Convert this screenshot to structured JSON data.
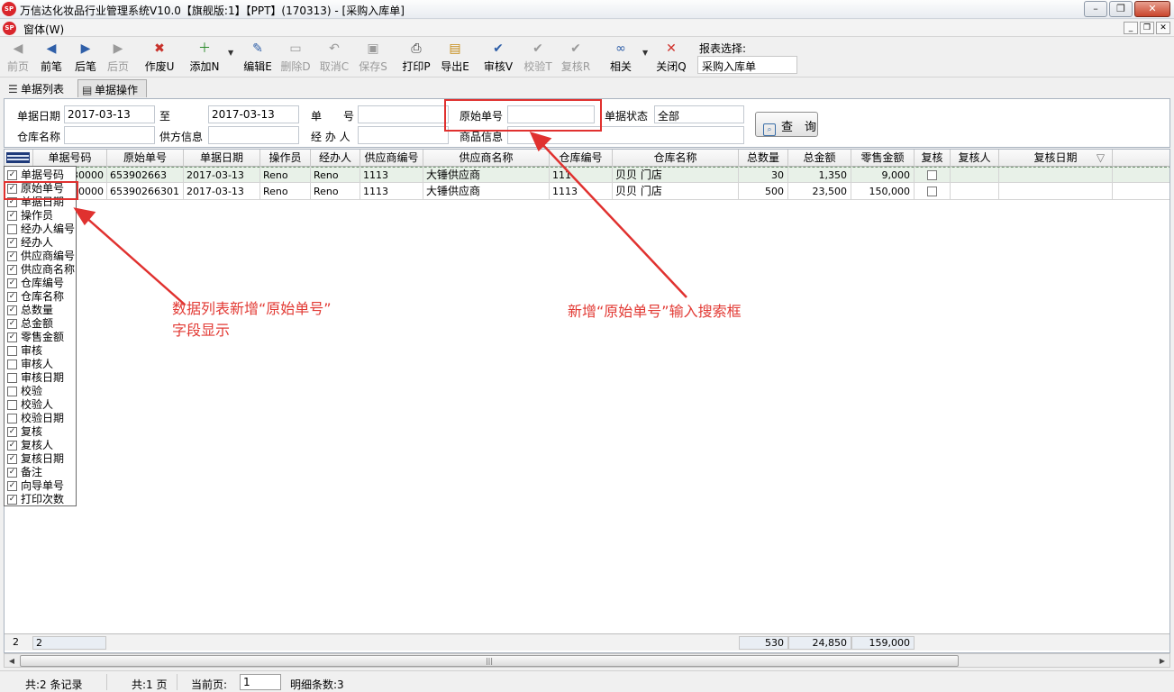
{
  "window": {
    "title": "万信达化妆品行业管理系统V10.0【旗舰版:1】【PPT】(170313) - [采购入库单]",
    "logo_text": "SP"
  },
  "menubar": {
    "label": "窗体(W)"
  },
  "toolbar": {
    "buttons": [
      {
        "label": "前页",
        "icon": "first-page-icon",
        "glyph": "◀",
        "enabled": false
      },
      {
        "label": "前笔",
        "icon": "prev-record-icon",
        "glyph": "◀",
        "enabled": true
      },
      {
        "label": "后笔",
        "icon": "next-record-icon",
        "glyph": "▶",
        "enabled": true
      },
      {
        "label": "后页",
        "icon": "last-page-icon",
        "glyph": "▶",
        "enabled": false
      },
      {
        "label": "作废U",
        "icon": "void-doc-icon",
        "glyph": "✖",
        "enabled": true
      },
      {
        "label": "添加N",
        "icon": "add-doc-icon",
        "glyph": "＋",
        "enabled": true
      },
      {
        "label": "编辑E",
        "icon": "edit-doc-icon",
        "glyph": "✎",
        "enabled": true
      },
      {
        "label": "删除D",
        "icon": "delete-doc-icon",
        "glyph": "▭",
        "enabled": false
      },
      {
        "label": "取消C",
        "icon": "undo-icon",
        "glyph": "↶",
        "enabled": false
      },
      {
        "label": "保存S",
        "icon": "save-icon",
        "glyph": "▣",
        "enabled": false
      },
      {
        "label": "打印P",
        "icon": "printer-icon",
        "glyph": "⎙",
        "enabled": true
      },
      {
        "label": "导出E",
        "icon": "export-folder-icon",
        "glyph": "▤",
        "enabled": true
      },
      {
        "label": "审核V",
        "icon": "approve-icon",
        "glyph": "✔",
        "enabled": true
      },
      {
        "label": "校验T",
        "icon": "verify-icon",
        "glyph": "✔",
        "enabled": false
      },
      {
        "label": "复核R",
        "icon": "recheck-icon",
        "glyph": "✔",
        "enabled": false
      },
      {
        "label": "相关",
        "icon": "link-icon",
        "glyph": "∞",
        "enabled": true
      },
      {
        "label": "关闭Q",
        "icon": "close-x-icon",
        "glyph": "✕",
        "enabled": true
      }
    ],
    "report_label": "报表选择:",
    "report_value": "采购入库单"
  },
  "tabs": [
    {
      "label": "单据列表",
      "icon": "list-icon"
    },
    {
      "label": "单据操作",
      "icon": "form-icon"
    }
  ],
  "filters": {
    "date_label": "单据日期",
    "date_from": "2017-03-13",
    "to_label": "至",
    "date_to": "2017-03-13",
    "doc_no_label": "单　　号",
    "doc_no_value": "",
    "orig_no_label": "原始单号",
    "orig_no_value": "",
    "status_label": "单据状态",
    "status_value": "全部",
    "warehouse_label": "仓库名称",
    "warehouse_value": "",
    "supplier_label": "供方信息",
    "supplier_value": "",
    "handler_label": "经 办 人",
    "handler_value": "",
    "product_label": "商品信息",
    "product_value": "",
    "query_button": "查　询"
  },
  "grid": {
    "headers": [
      "单据号码",
      "原始单号",
      "单据日期",
      "操作员",
      "经办人",
      "供应商编号",
      "供应商名称",
      "仓库编号",
      "仓库名称",
      "总数量",
      "总金额",
      "零售金额",
      "复核",
      "复核人",
      "复核日期",
      "▽"
    ],
    "rows": [
      {
        "doc_no": "130000",
        "orig_no": "653902663",
        "date": "2017-03-13",
        "operator": "Reno",
        "handler": "Reno",
        "supplier_code": "1113",
        "supplier_name": "大锤供应商",
        "wh_code": "111",
        "wh_name": "贝贝 门店",
        "qty": "30",
        "amount": "1,350",
        "retail": "9,000",
        "rechecked": false
      },
      {
        "doc_no": "30000",
        "orig_no": "65390266301",
        "date": "2017-03-13",
        "operator": "Reno",
        "handler": "Reno",
        "supplier_code": "1113",
        "supplier_name": "大锤供应商",
        "wh_code": "1113",
        "wh_name": "贝贝 门店",
        "qty": "500",
        "amount": "23,500",
        "retail": "150,000",
        "rechecked": false
      }
    ],
    "column_chooser": [
      {
        "label": "单据号码",
        "checked": true
      },
      {
        "label": "原始单号",
        "checked": true
      },
      {
        "label": "单据日期",
        "checked": true
      },
      {
        "label": "操作员",
        "checked": true
      },
      {
        "label": "经办人编号",
        "checked": false
      },
      {
        "label": "经办人",
        "checked": true
      },
      {
        "label": "供应商编号",
        "checked": true
      },
      {
        "label": "供应商名称",
        "checked": true
      },
      {
        "label": "仓库编号",
        "checked": true
      },
      {
        "label": "仓库名称",
        "checked": true
      },
      {
        "label": "总数量",
        "checked": true
      },
      {
        "label": "总金额",
        "checked": true
      },
      {
        "label": "零售金额",
        "checked": true
      },
      {
        "label": "审核",
        "checked": false
      },
      {
        "label": "审核人",
        "checked": false
      },
      {
        "label": "审核日期",
        "checked": false
      },
      {
        "label": "校验",
        "checked": false
      },
      {
        "label": "校验人",
        "checked": false
      },
      {
        "label": "校验日期",
        "checked": false
      },
      {
        "label": "复核",
        "checked": true
      },
      {
        "label": "复核人",
        "checked": true
      },
      {
        "label": "复核日期",
        "checked": true
      },
      {
        "label": "备注",
        "checked": true
      },
      {
        "label": "向导单号",
        "checked": true
      },
      {
        "label": "打印次数",
        "checked": true
      }
    ],
    "footer": {
      "row_count": "2",
      "row_count_box": "2",
      "total_qty": "530",
      "total_amount": "24,850",
      "total_retail": "159,000"
    }
  },
  "statusbar": {
    "records": "共:2 条记录",
    "pages": "共:1 页",
    "current_page_label": "当前页:",
    "current_page": "1",
    "detail_count": "明细条数:3"
  },
  "annotations": {
    "left_note_line1": "数据列表新增“原始单号”",
    "left_note_line2": "字段显示",
    "right_note": "新增“原始单号”输入搜索框",
    "color": "#e0312f"
  }
}
